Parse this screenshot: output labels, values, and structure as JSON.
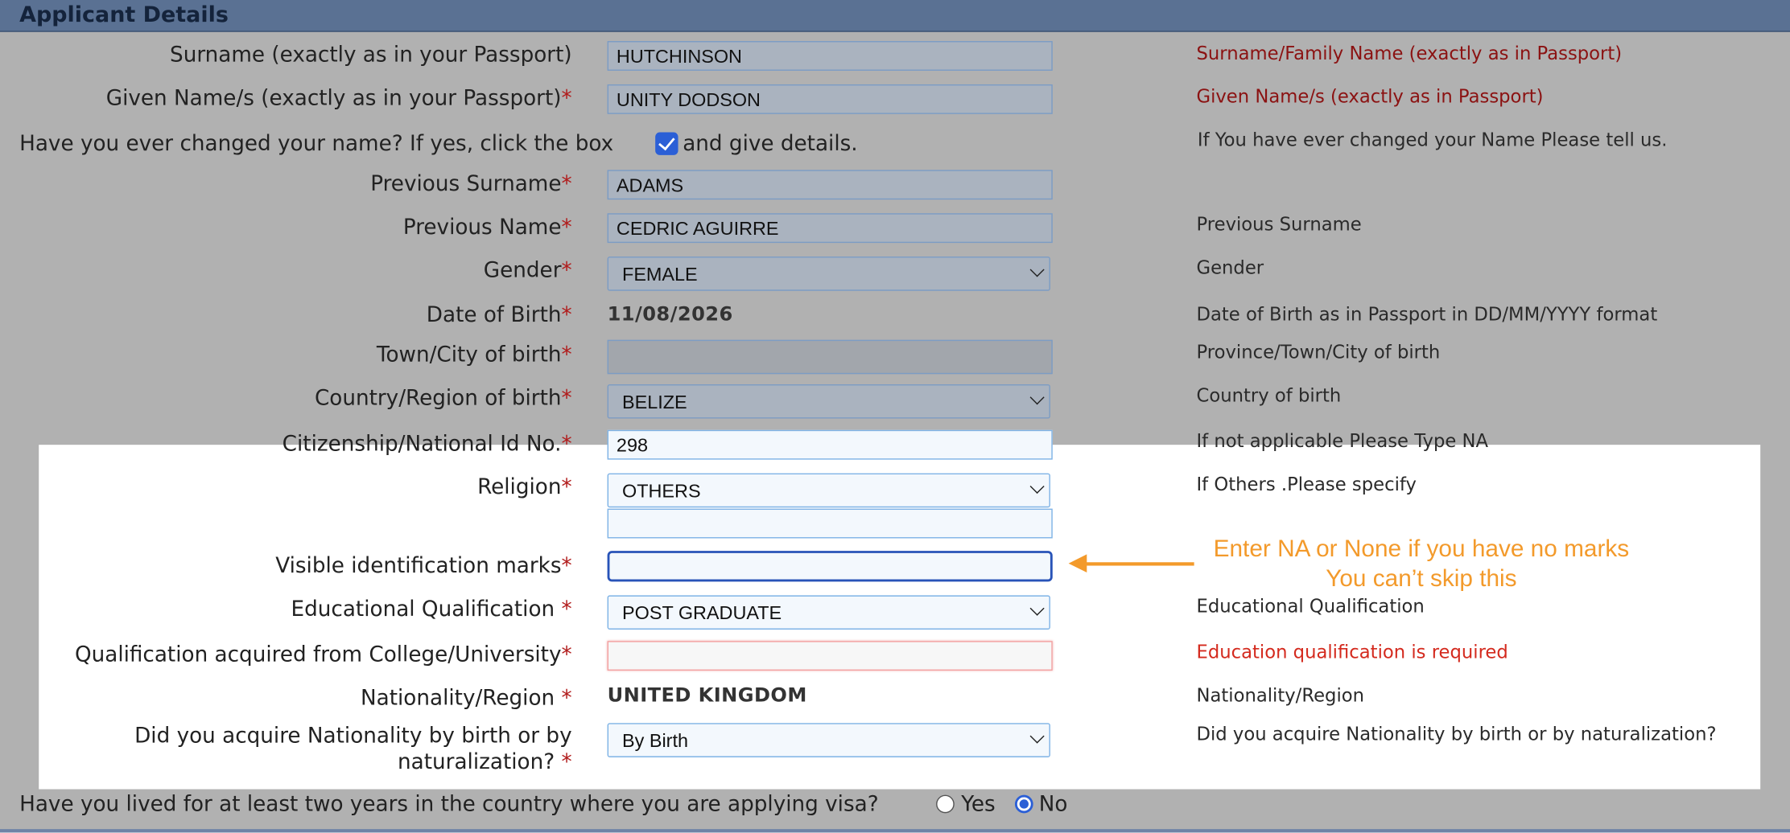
{
  "section_title": "Applicant Details",
  "fields": {
    "surname": {
      "label": "Surname (exactly as in your Passport)",
      "value": "HUTCHINSON",
      "hint": "Surname/Family Name (exactly as in Passport)"
    },
    "given_name": {
      "label": "Given Name/s (exactly as in your Passport)",
      "value": "UNITY DODSON",
      "hint": "Given Name/s (exactly as in Passport)"
    },
    "changed_name": {
      "label_before": "Have you ever changed your name? If yes, click the box",
      "label_after": "and give details.",
      "checked": true,
      "hint": "If You have ever changed your Name Please tell us."
    },
    "previous_surname": {
      "label": "Previous Surname",
      "value": "ADAMS"
    },
    "previous_name": {
      "label": "Previous Name",
      "value": "CEDRIC AGUIRRE",
      "hint": "Previous Surname"
    },
    "gender": {
      "label": "Gender",
      "value": "FEMALE",
      "hint": "Gender"
    },
    "dob": {
      "label": "Date of Birth",
      "value": "11/08/2026",
      "hint": "Date of Birth as in Passport in DD/MM/YYYY format"
    },
    "town_of_birth": {
      "label": "Town/City of birth",
      "value": "",
      "hint": "Province/Town/City of birth"
    },
    "country_of_birth": {
      "label": "Country/Region of birth",
      "value": "BELIZE",
      "hint": "Country of birth"
    },
    "citizenship_id": {
      "label": "Citizenship/National Id No.",
      "value": "298",
      "hint": "If not applicable Please Type NA"
    },
    "religion": {
      "label": "Religion",
      "value": "OTHERS",
      "hint": "If Others .Please specify",
      "other_value": ""
    },
    "identification_marks": {
      "label": "Visible identification marks",
      "value": "",
      "note_line1": "Enter NA or None if you have no marks",
      "note_line2": "You can’t skip this"
    },
    "education": {
      "label": "Educational Qualification ",
      "value": "POST GRADUATE",
      "hint": "Educational Qualification"
    },
    "qualification_college": {
      "label": "Qualification acquired from College/University",
      "value": "",
      "error": "Education qualification is required"
    },
    "nationality": {
      "label": "Nationality/Region ",
      "value": "UNITED KINGDOM",
      "hint": "Nationality/Region"
    },
    "nationality_acquired": {
      "label": "Did you acquire Nationality by birth or by naturalization? ",
      "value": "By Birth",
      "hint": "Did you acquire Nationality by birth or by naturalization?"
    },
    "lived_two_years": {
      "label": "Have you lived for at least two years in the country where you are applying visa?",
      "option_yes": "Yes",
      "option_no": "No",
      "selected": "No"
    }
  },
  "required_mark": "*",
  "colors": {
    "header": "#5a7193",
    "overlay": "#b1b1b1",
    "accent": "#2b5fd6",
    "note": "#f39a2b",
    "error": "#d42a1e",
    "hint_red": "#8b1212"
  }
}
